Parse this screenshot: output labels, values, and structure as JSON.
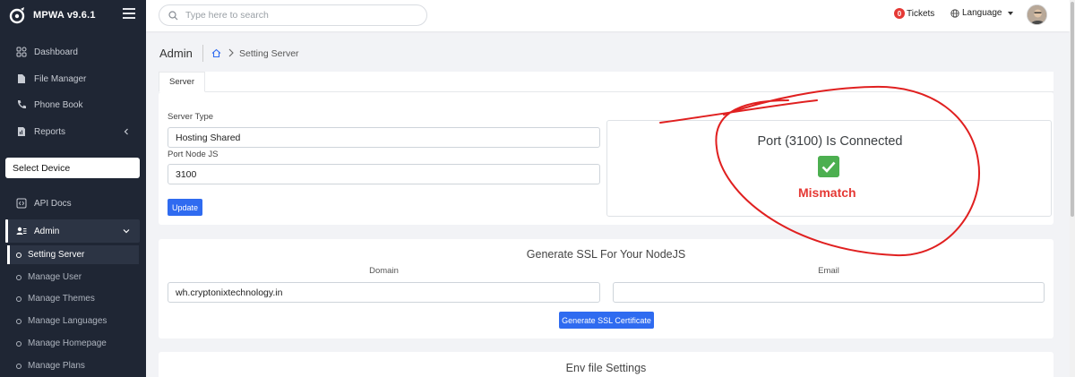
{
  "brand": {
    "name": "MPWA v9.6.1"
  },
  "sidebar": {
    "items": [
      {
        "label": "Dashboard",
        "icon": "dashboard-icon"
      },
      {
        "label": "File Manager",
        "icon": "file-icon"
      },
      {
        "label": "Phone Book",
        "icon": "phone-icon"
      },
      {
        "label": "Reports",
        "icon": "report-icon"
      }
    ],
    "select_device": "Select Device",
    "api_docs": "API Docs",
    "admin": "Admin",
    "admin_sub": [
      {
        "label": "Setting Server",
        "active": true
      },
      {
        "label": "Manage User"
      },
      {
        "label": "Manage Themes"
      },
      {
        "label": "Manage Languages"
      },
      {
        "label": "Manage Homepage"
      },
      {
        "label": "Manage Plans"
      }
    ]
  },
  "topbar": {
    "search_placeholder": "Type here to search",
    "tickets_count": "0",
    "tickets_label": "Tickets",
    "language_label": "Language"
  },
  "breadcrumb": {
    "title": "Admin",
    "current": "Setting Server"
  },
  "tabs": [
    {
      "label": "Server",
      "active": true
    }
  ],
  "server_form": {
    "server_type_label": "Server Type",
    "server_type_value": "Hosting Shared",
    "port_label": "Port Node JS",
    "port_value": "3100",
    "update_label": "Update"
  },
  "status": {
    "title": "Port (3100) Is Connected",
    "mismatch": "Mismatch",
    "check_color": "#4caf50",
    "mismatch_color": "#e53935"
  },
  "ssl": {
    "title": "Generate SSL For Your NodeJS",
    "domain_label": "Domain",
    "domain_value": "wh.cryptonixtechnology.in",
    "email_label": "Email",
    "email_value": "",
    "button_label": "Generate SSL Certificate"
  },
  "env": {
    "title": "Env file Settings"
  },
  "colors": {
    "sidebar_bg": "#1f2634",
    "primary": "#2f6bf0",
    "annotation": "#e02020"
  }
}
